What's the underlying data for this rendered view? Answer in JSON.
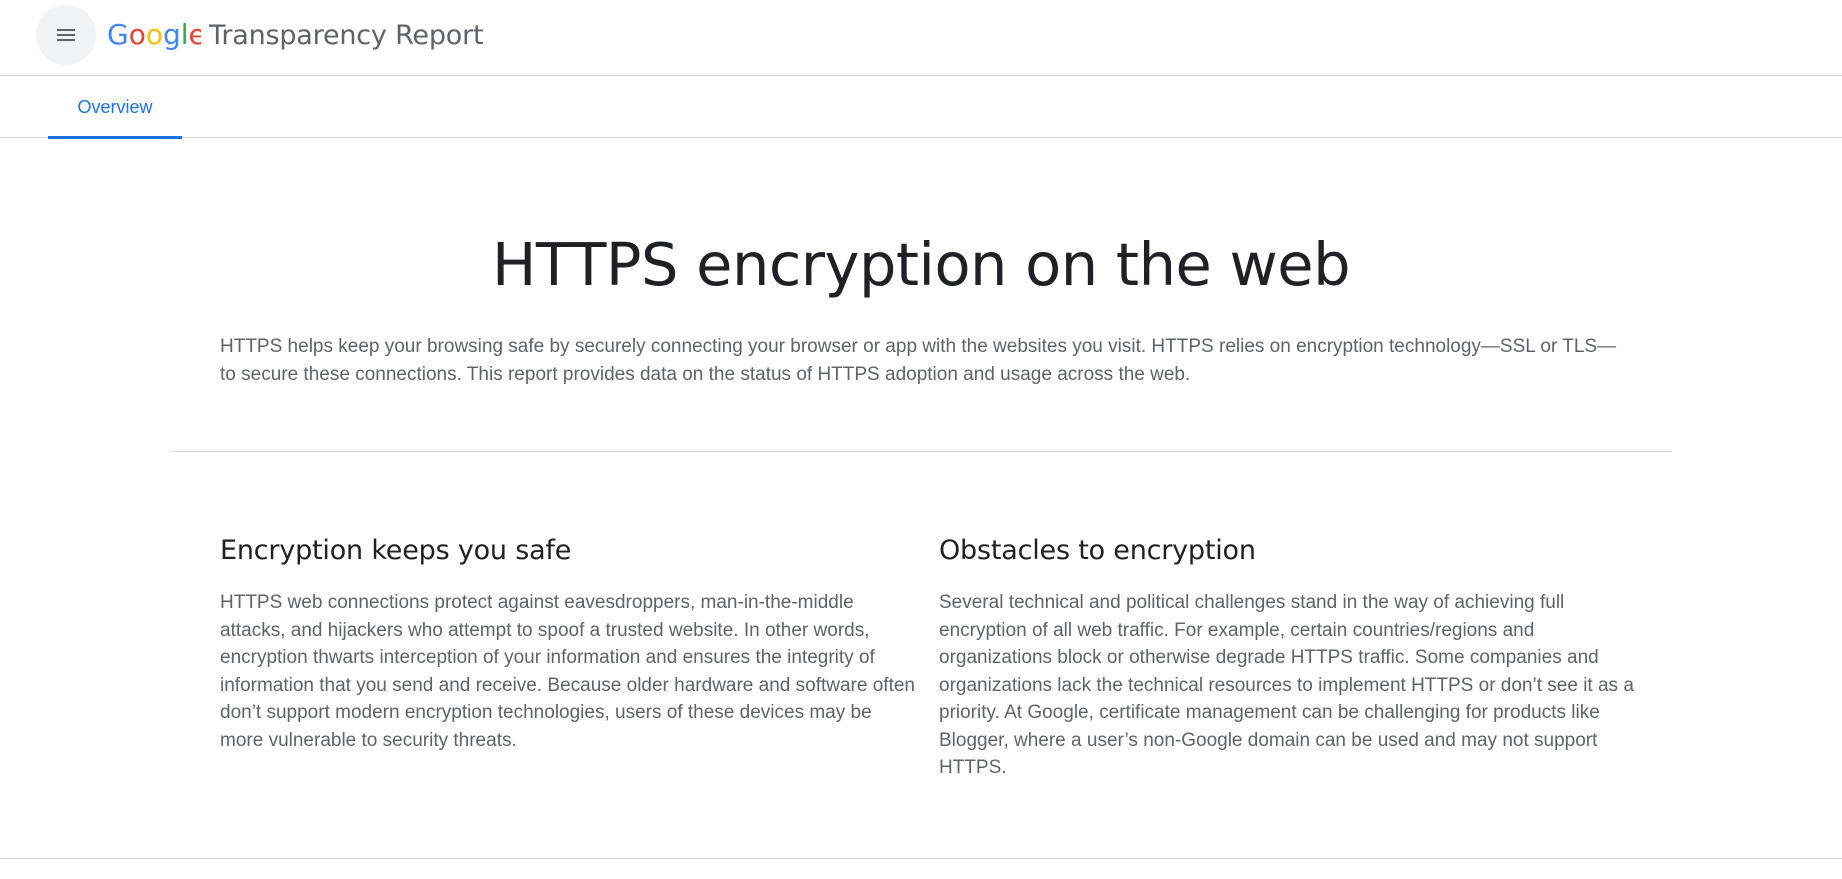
{
  "header": {
    "menu_icon": "hamburger-menu-icon",
    "logo": {
      "text": "Google",
      "letters": [
        "G",
        "o",
        "o",
        "g",
        "l",
        "e"
      ],
      "colors": [
        "#4285F4",
        "#EA4335",
        "#FBBC05",
        "#4285F4",
        "#34A853",
        "#EA4335"
      ]
    },
    "product_name": "Transparency Report"
  },
  "tabs": [
    {
      "label": "Overview",
      "active": true
    }
  ],
  "hero": {
    "title": "HTTPS encryption on the web",
    "intro": "HTTPS helps keep your browsing safe by securely connecting your browser or app with the websites you visit. HTTPS relies on encryption technology—SSL or TLS—to secure these connections. This report provides data on the status of HTTPS adoption and usage across the web."
  },
  "sections": [
    {
      "heading": "Encryption keeps you safe",
      "body": "HTTPS web connections protect against eavesdroppers, man-in-the-middle attacks, and hijackers who attempt to spoof a trusted website. In other words, encryption thwarts interception of your information and ensures the integrity of information that you send and receive. Because older hardware and software often don’t support modern encryption technologies, users of these devices may be more vulnerable to security threats."
    },
    {
      "heading": "Obstacles to encryption",
      "body": "Several technical and political challenges stand in the way of achieving full encryption of all web traffic. For example, certain countries/regions and organizations block or otherwise degrade HTTPS traffic. Some companies and organizations lack the technical resources to implement HTTPS or don’t see it as a priority. At Google, certificate management can be challenging for products like Blogger, where a user’s non-Google domain can be used and may not support HTTPS."
    }
  ],
  "colors": {
    "accent": "#1a73e8",
    "text_primary": "#202124",
    "text_secondary": "#5f6368",
    "divider": "#dadce0"
  }
}
